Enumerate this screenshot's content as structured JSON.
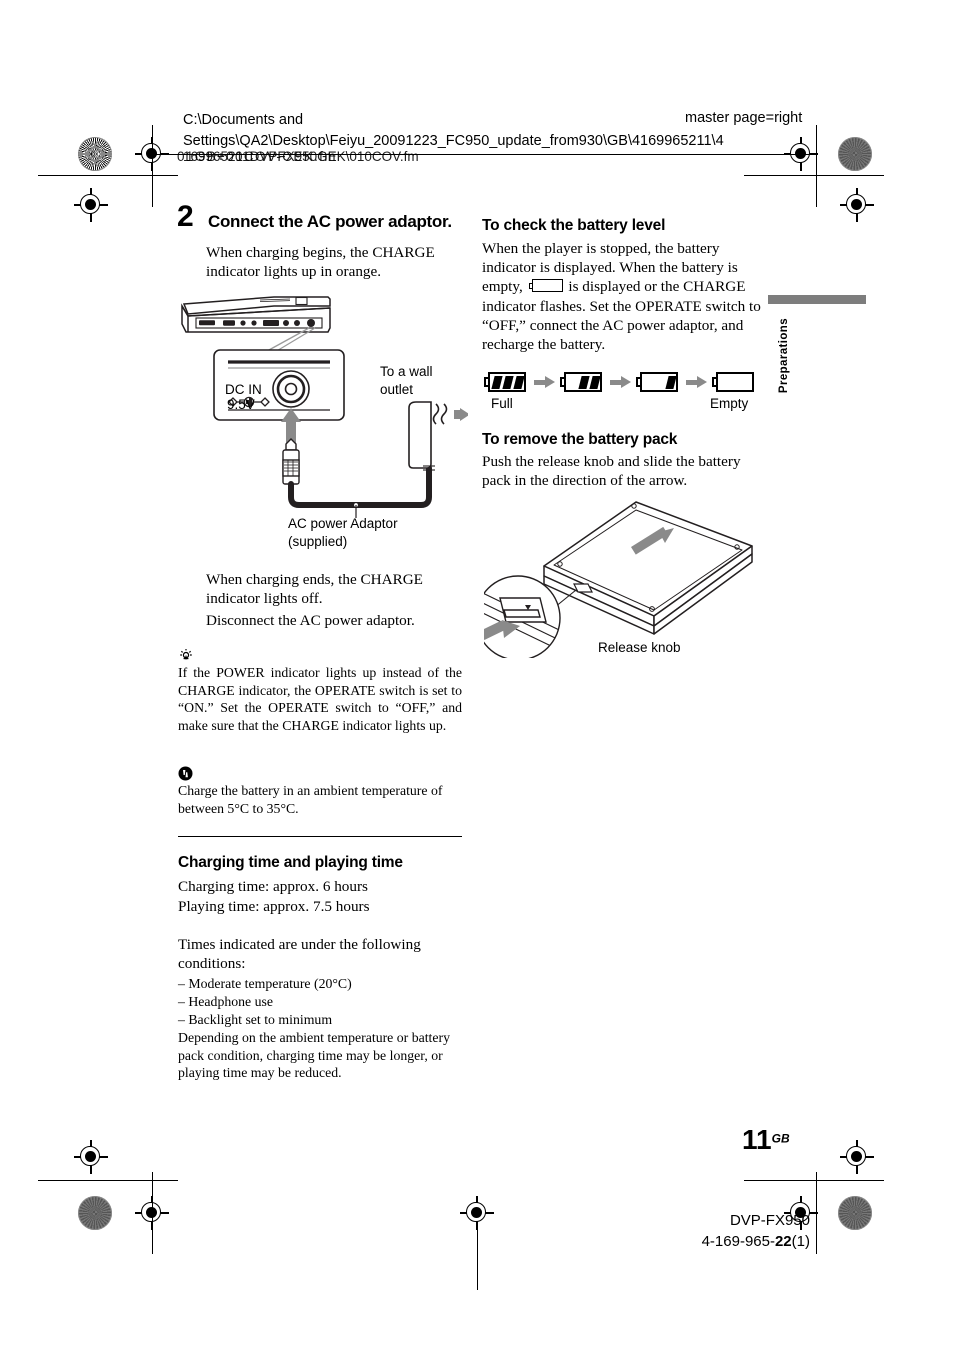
{
  "header": {
    "path_line1": "C:\\Documents and",
    "path_line2": "Settings\\QA2\\Desktop\\Feiyu_20091223_FC950_update_from930\\GB\\4169965211\\4",
    "path_line3_a": "169965211DVPFX950GEK\\010COV.fm",
    "path_line3_b": "01GB+00COV-CEK.fm",
    "master_page": "master page=right"
  },
  "step": {
    "number": "2",
    "title": "Connect the AC power adaptor.",
    "body_line1": "When charging begins, the CHARGE",
    "body_line2": "indicator lights up in orange."
  },
  "figure_left": {
    "dcin_label_line1": "DC IN",
    "dcin_label_line2": "9.5V",
    "wall_label_line1": "To a wall",
    "wall_label_line2": "outlet",
    "adaptor_label_line1": "AC power Adaptor",
    "adaptor_label_line2": "(supplied)"
  },
  "after_figure": {
    "line1": "When charging ends, the CHARGE",
    "line2": "indicator lights off.",
    "line3": "Disconnect the AC power adaptor."
  },
  "tip": {
    "icon": "tip-bulb-icon",
    "text": "If the POWER indicator lights up instead of the CHARGE indicator, the OPERATE switch is set to “ON.” Set the OPERATE switch to “OFF,” and make sure that the CHARGE indicator lights up."
  },
  "note": {
    "icon": "note-exclamation-icon",
    "text": "Charge the battery in an ambient temperature of between 5°C to 35°C."
  },
  "charging_section": {
    "heading": "Charging time and playing time",
    "line1": "Charging time: approx. 6 hours",
    "line2": "Playing time: approx. 7.5 hours",
    "conditions_intro_1": "Times indicated are under the following",
    "conditions_intro_2": "conditions:",
    "conditions": [
      "– Moderate temperature (20°C)",
      "– Headphone use",
      "– Backlight set to minimum"
    ],
    "footnote": "Depending on the ambient temperature or battery pack condition, charging time may be longer, or playing time may be reduced."
  },
  "battery_level": {
    "heading": "To check the battery level",
    "text_before": "When the player is stopped, the battery indicator is displayed. When the battery is empty,",
    "text_after": "is displayed or the CHARGE indicator flashes. Set the OPERATE switch to “OFF,” connect the AC power adaptor, and recharge the battery.",
    "label_full": "Full",
    "label_empty": "Empty",
    "levels": [
      3,
      2,
      1,
      0
    ]
  },
  "remove_battery": {
    "heading": "To remove the battery pack",
    "text": "Push the release knob and slide the battery pack in the direction of the arrow.",
    "callout_label": "Release knob"
  },
  "sidetab": {
    "label": "Preparations",
    "bar_color": "#7d7d7d"
  },
  "page_footer": {
    "page_number": "11",
    "page_sup": "GB",
    "model": "DVP-FX950",
    "part_number_pre": "4-169-965-",
    "part_number_bold": "22",
    "part_number_post": "(1)"
  }
}
